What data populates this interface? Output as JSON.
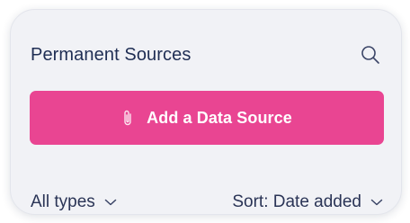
{
  "panel": {
    "title": "Permanent Sources",
    "search_icon": "search-icon",
    "add_button": {
      "label": "Add a Data Source",
      "icon": "paperclip-icon",
      "color": "#e94592"
    },
    "filters": {
      "types_label": "All types",
      "sort_label": "Sort: Date added"
    }
  },
  "colors": {
    "panel_bg": "#f1f2f6",
    "text": "#1f2e54",
    "accent": "#e94592"
  }
}
